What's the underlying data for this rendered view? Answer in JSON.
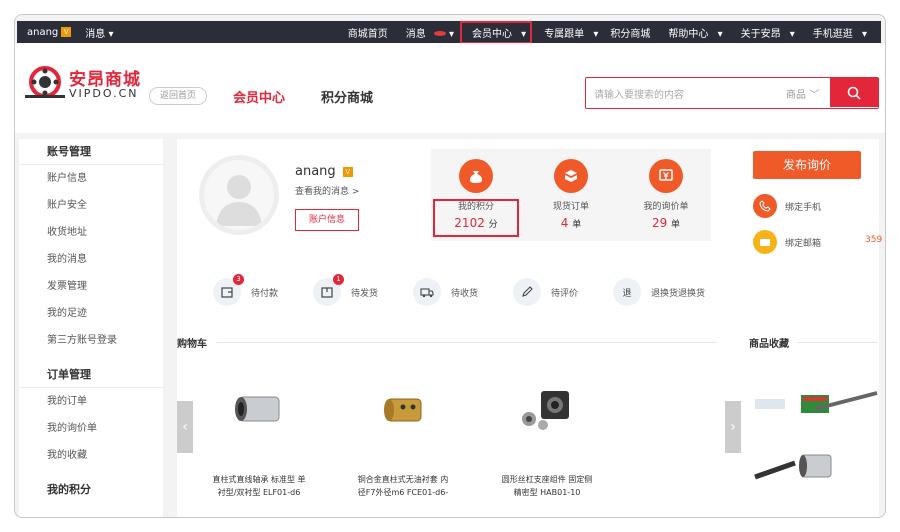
{
  "topbar": {
    "username": "anang",
    "user_badge": "V",
    "messages": "消息",
    "nav": {
      "home": "商城首页",
      "messages": "消息",
      "member_center": "会员中心",
      "exclusive": "专属跟单",
      "points_mall": "积分商城",
      "help": "帮助中心",
      "about": "关于安昂",
      "mobile": "手机逛逛"
    }
  },
  "header": {
    "logo_cn": "安昂商城",
    "logo_en": "VIPDO.CN",
    "back_home": "返回首页",
    "nav_member": "会员中心",
    "nav_points": "积分商城",
    "search_placeholder": "请输入要搜索的内容",
    "search_category": "商品"
  },
  "sidebar": {
    "groups": [
      {
        "title": "账号管理",
        "items": [
          "账户信息",
          "账户安全",
          "收货地址",
          "我的消息",
          "发票管理",
          "我的足迹",
          "第三方账号登录"
        ]
      },
      {
        "title": "订单管理",
        "items": [
          "我的订单",
          "我的询价单",
          "我的收藏"
        ]
      },
      {
        "title": "我的积分",
        "items": []
      }
    ]
  },
  "profile": {
    "name": "anang",
    "badge": "V",
    "view_messages": "查看我的消息 >",
    "account_info_button": "账户信息"
  },
  "stats": [
    {
      "label": "我的积分",
      "value": "2102",
      "unit": "分",
      "icon": "money-bag-icon"
    },
    {
      "label": "现货订单",
      "value": "4",
      "unit": "单",
      "icon": "box-icon"
    },
    {
      "label": "我的询价单",
      "value": "29",
      "unit": "单",
      "icon": "yen-icon"
    }
  ],
  "actions": {
    "publish_inquiry": "发布询价",
    "bind_phone": "绑定手机",
    "bind_email": "绑定邮箱",
    "side_number": "359"
  },
  "orders": [
    {
      "label": "待付款",
      "badge": "3"
    },
    {
      "label": "待发货",
      "badge": "1"
    },
    {
      "label": "待收货",
      "badge": ""
    },
    {
      "label": "待评价",
      "badge": ""
    },
    {
      "label": "退换货退换货",
      "badge": ""
    }
  ],
  "cart": {
    "title": "购物车",
    "products": [
      {
        "name_line1": "直柱式直线轴承 标准型 单",
        "name_line2": "衬型/双衬型 ELF01-d6"
      },
      {
        "name_line1": "铜合金直柱式无油衬套 内",
        "name_line2": "径F7外径m6 FCE01-d6-"
      },
      {
        "name_line1": "圆形丝杠支座组件 固定侧",
        "name_line2": "精密型 HAB01-10"
      }
    ]
  },
  "favorites": {
    "title": "商品收藏"
  },
  "colors": {
    "brand_red": "#e3263a",
    "orange": "#f05a28",
    "topbar_bg": "#2b2e38"
  }
}
